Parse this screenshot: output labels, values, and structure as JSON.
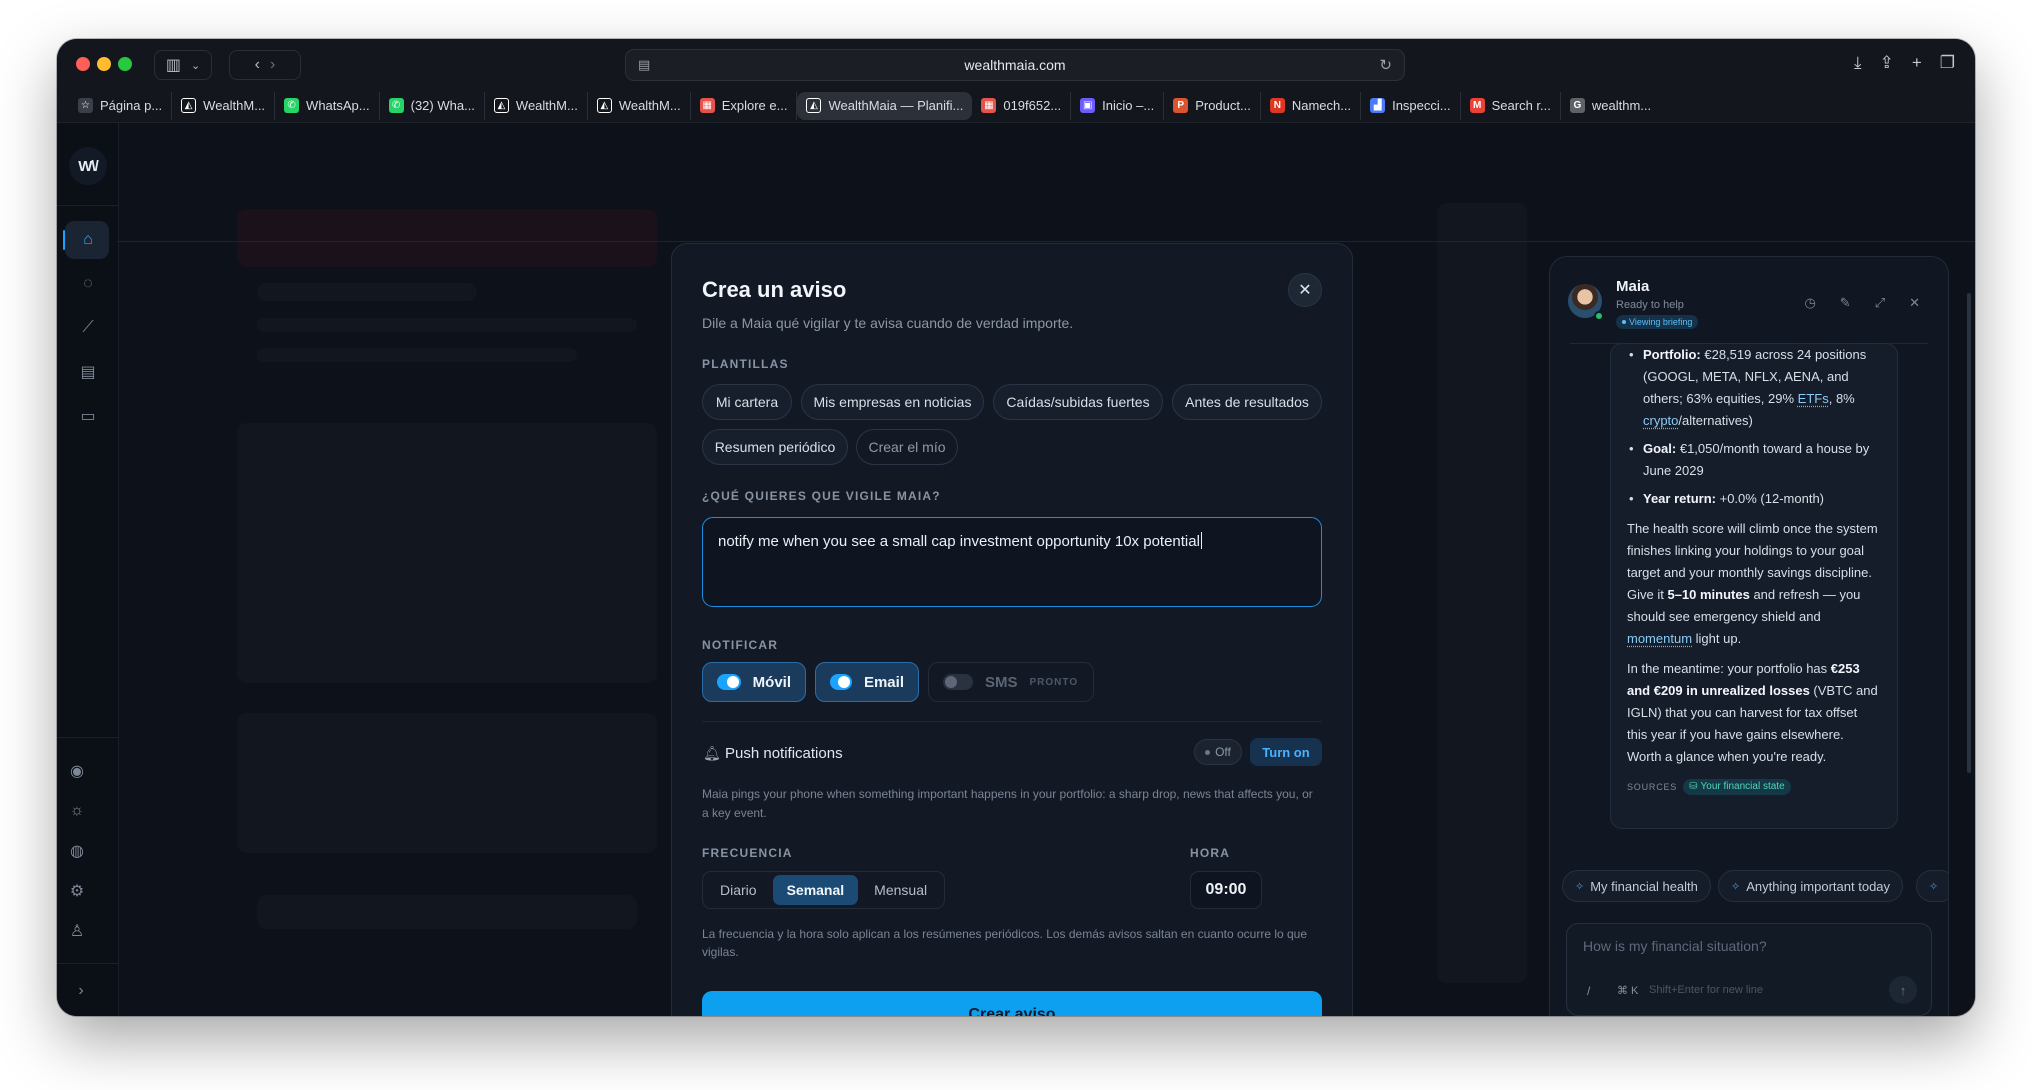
{
  "browser": {
    "url": "wealthmaia.com",
    "tabs": [
      {
        "label": "Página p...",
        "icon": "star-icon",
        "color": "#3b3f47",
        "glyph": "☆"
      },
      {
        "label": "WealthM...",
        "icon": "wealthmaia-favicon",
        "color": "#ffffff",
        "glyph": "◭"
      },
      {
        "label": "WhatsAp...",
        "icon": "whatsapp-icon",
        "color": "#25d366",
        "glyph": "✆"
      },
      {
        "label": "(32) Wha...",
        "icon": "whatsapp-icon",
        "color": "#25d366",
        "glyph": "✆"
      },
      {
        "label": "WealthM...",
        "icon": "wealthmaia-favicon",
        "color": "#ffffff",
        "glyph": "◭"
      },
      {
        "label": "WealthM...",
        "icon": "wealthmaia-favicon",
        "color": "#ffffff",
        "glyph": "◭"
      },
      {
        "label": "Explore e...",
        "icon": "explore-favicon",
        "color": "#e5534b",
        "glyph": "▦"
      },
      {
        "label": "WealthMaia — Planifi...",
        "icon": "wealthmaia-favicon",
        "color": "#ffffff",
        "glyph": "◭",
        "active": true
      },
      {
        "label": "019f652...",
        "icon": "doc-favicon",
        "color": "#e5534b",
        "glyph": "▦"
      },
      {
        "label": "Inicio –...",
        "icon": "inicio-favicon",
        "color": "#6b5cff",
        "glyph": "▣"
      },
      {
        "label": "Product...",
        "icon": "producthunt-icon",
        "color": "#da552f",
        "glyph": "P"
      },
      {
        "label": "Namech...",
        "icon": "namecheap-icon",
        "color": "#de3723",
        "glyph": "N"
      },
      {
        "label": "Inspecci...",
        "icon": "chart-favicon",
        "color": "#4a7cf7",
        "glyph": "▟"
      },
      {
        "label": "Search r...",
        "icon": "gmail-icon",
        "color": "#ea4335",
        "glyph": "M"
      },
      {
        "label": "wealthm...",
        "icon": "google-icon",
        "color": "#5f6368",
        "glyph": "G"
      }
    ]
  },
  "app": {
    "logo": "W\\/",
    "rail_top": [
      "home-icon",
      "chat-icon",
      "chart-icon",
      "document-icon",
      "news-icon"
    ],
    "rail_bottom": [
      "eye-icon",
      "sun-icon",
      "globe-icon",
      "settings-icon",
      "user-icon"
    ]
  },
  "modal": {
    "title": "Crea un aviso",
    "subtitle": "Dile a Maia qué vigilar y te avisa cuando de verdad importe.",
    "templates_label": "PLANTILLAS",
    "templates": [
      "Mi cartera",
      "Mis empresas en noticias",
      "Caídas/subidas fuertes",
      "Antes de resultados",
      "Resumen periódico",
      "Crear el mío"
    ],
    "watch_label": "¿QUÉ QUIERES QUE VIGILE MAIA?",
    "watch_value": "notify me when you see a small cap investment opportunity 10x potential",
    "notify_label": "NOTIFICAR",
    "channels": [
      {
        "label": "Móvil",
        "enabled": true
      },
      {
        "label": "Email",
        "enabled": true
      },
      {
        "label": "SMS",
        "enabled": false,
        "badge": "PRONTO"
      }
    ],
    "push": {
      "title": "Push notifications",
      "status": "Off",
      "action": "Turn on",
      "description": "Maia pings your phone when something important happens in your portfolio: a sharp drop, news that affects you, or a key event."
    },
    "frequency_label": "FRECUENCIA",
    "frequency_options": [
      "Diario",
      "Semanal",
      "Mensual"
    ],
    "frequency_selected": "Semanal",
    "time_label": "HORA",
    "time_value": "09:00",
    "frequency_note": "La frecuencia y la hora solo aplican a los resúmenes periódicos. Los demás avisos saltan en cuanto ocurre lo que vigilas.",
    "submit": "Crear aviso",
    "accent": "#0ea0f0"
  },
  "maia": {
    "name": "Maia",
    "status": "Ready to help",
    "badge": "Viewing briefing",
    "bullets": [
      {
        "key": "Portfolio:",
        "text": " €28,519 across 24 positions (GOOGL, META, NFLX, AENA, and others; 63% equities, 29% ",
        "link1": "ETFs",
        "mid": ", 8% ",
        "link2": "crypto",
        "tail": "/alternatives)"
      },
      {
        "key": "Goal:",
        "text": " €1,050/month toward a house by June 2029"
      },
      {
        "key": "Year return:",
        "text": " +0.0% (12-month)"
      }
    ],
    "para1": {
      "a": "The health score will climb once the system finishes linking your holdings to your goal target and your monthly savings discipline. Give it ",
      "bold": "5–10 minutes",
      "b": " and refresh — you should see emergency shield and ",
      "link": "momentum",
      "c": " light up."
    },
    "para2": {
      "a": "In the meantime: your portfolio has ",
      "bold": "€253 and €209 in unrealized losses",
      "b": " (VBTC and IGLN) that you can harvest for tax offset this year if you have gains elsewhere. Worth a glance when you're ready."
    },
    "sources_label": "SOURCES",
    "source": "Your financial state",
    "suggestions": [
      "My financial health",
      "Anything important today"
    ],
    "input_placeholder": "How is my financial situation?",
    "slash": "/",
    "kbd": "⌘ K",
    "hint": "Shift+Enter for new line"
  }
}
